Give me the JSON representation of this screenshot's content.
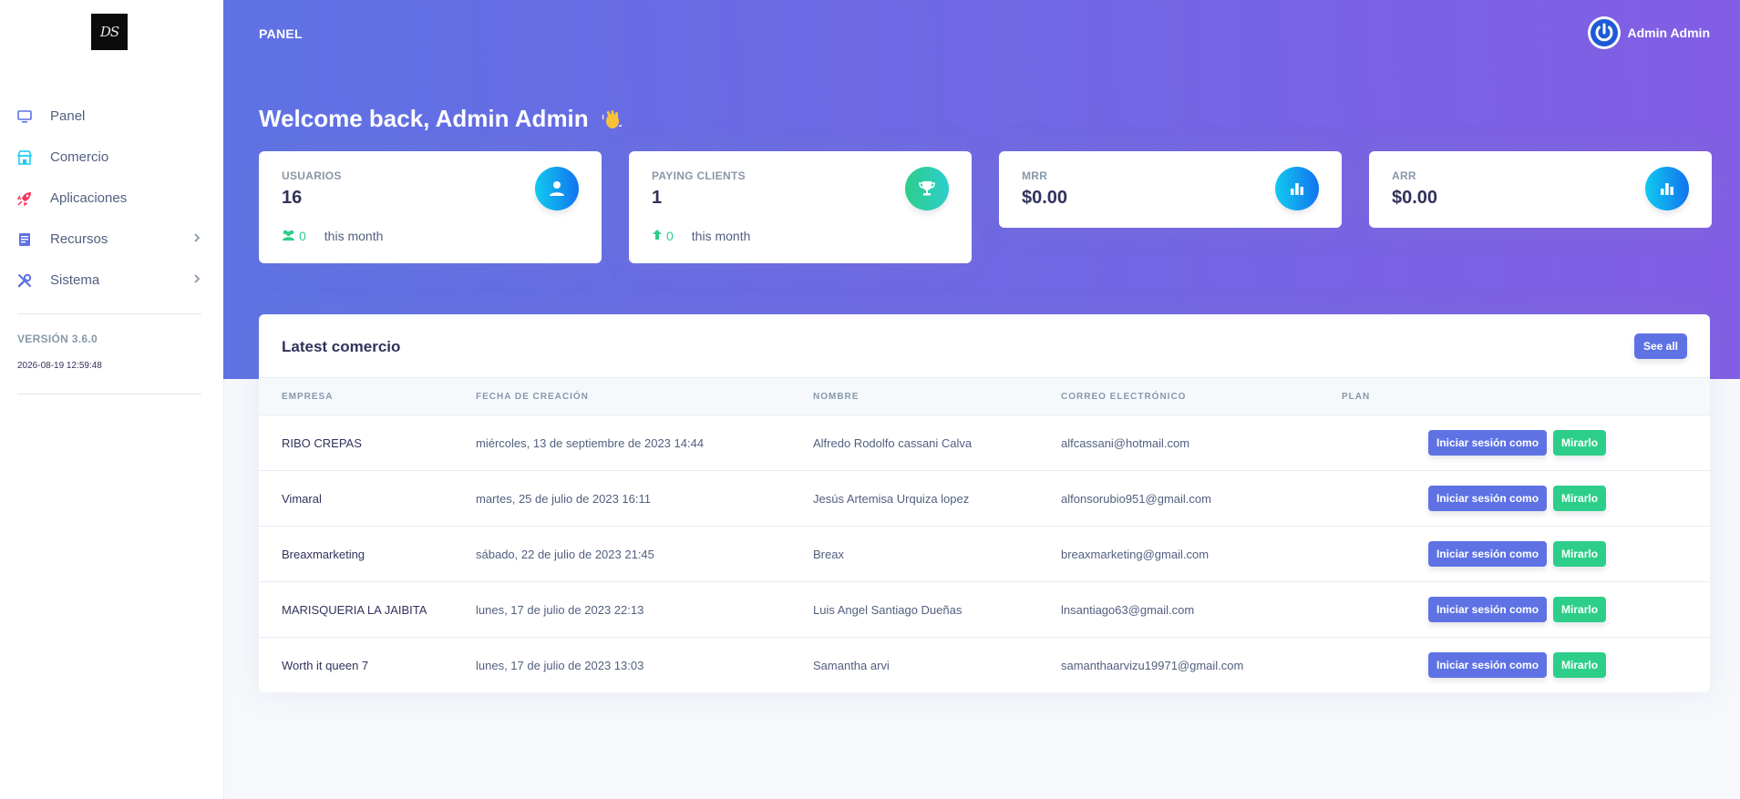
{
  "sidebar": {
    "logo_text": "DS",
    "items": [
      {
        "label": "Panel",
        "icon": "monitor-icon",
        "color": "#5e72e4"
      },
      {
        "label": "Comercio",
        "icon": "store-icon",
        "color": "#11cdef"
      },
      {
        "label": "Aplicaciones",
        "icon": "rocket-icon",
        "color": "#f5365c"
      },
      {
        "label": "Recursos",
        "icon": "document-icon",
        "color": "#5e72e4",
        "has_submenu": true
      },
      {
        "label": "Sistema",
        "icon": "tools-icon",
        "color": "#5e72e4",
        "has_submenu": true
      }
    ],
    "version": "VERSIÓN 3.6.0",
    "datetime": "2026-08-19 12:59:48"
  },
  "header": {
    "breadcrumb": "PANEL",
    "user_name": "Admin Admin",
    "welcome": "Welcome back, Admin Admin",
    "welcome_emoji": "waving-hand-icon"
  },
  "stats": [
    {
      "title": "USUARIOS",
      "value": "16",
      "icon": "user-icon",
      "color": "#11cdef",
      "foot_icon": "users-icon",
      "foot_value": "0",
      "foot_text": "this month"
    },
    {
      "title": "PAYING CLIENTS",
      "value": "1",
      "icon": "trophy-icon",
      "color": "#2dce89",
      "foot_icon": "arrow-up-icon",
      "foot_value": "0",
      "foot_text": "this month"
    },
    {
      "title": "MRR",
      "value": "$0.00",
      "icon": "bar-chart-icon",
      "color": "#11cdef"
    },
    {
      "title": "ARR",
      "value": "$0.00",
      "icon": "bar-chart-icon",
      "color": "#11cdef"
    }
  ],
  "table": {
    "title": "Latest comercio",
    "see_all": "See all",
    "columns": [
      "EMPRESA",
      "FECHA DE CREACIÓN",
      "NOMBRE",
      "CORREO ELECTRÓNICO",
      "PLAN"
    ],
    "login_label": "Iniciar sesión como",
    "view_label": "Mirarlo",
    "rows": [
      {
        "empresa": "RIBO CREPAS",
        "fecha": "miércoles, 13 de septiembre de 2023 14:44",
        "nombre": "Alfredo Rodolfo cassani Calva",
        "correo": "alfcassani@hotmail.com",
        "plan": ""
      },
      {
        "empresa": "Vimaral",
        "fecha": "martes, 25 de julio de 2023 16:11",
        "nombre": "Jesús Artemisa Urquiza lopez",
        "correo": "alfonsorubio951@gmail.com",
        "plan": ""
      },
      {
        "empresa": "Breaxmarketing",
        "fecha": "sábado, 22 de julio de 2023 21:45",
        "nombre": "Breax",
        "correo": "breaxmarketing@gmail.com",
        "plan": ""
      },
      {
        "empresa": "MARISQUERIA LA JAIBITA",
        "fecha": "lunes, 17 de julio de 2023 22:13",
        "nombre": "Luis Angel Santiago Dueñas",
        "correo": "lnsantiago63@gmail.com",
        "plan": ""
      },
      {
        "empresa": "Worth it queen 7",
        "fecha": "lunes, 17 de julio de 2023 13:03",
        "nombre": "Samantha arvi",
        "correo": "samanthaarvizu19971@gmail.com",
        "plan": ""
      }
    ]
  },
  "colors": {
    "primary": "#5e72e4",
    "purple": "#825ee4",
    "success": "#2dce89",
    "info": "#11cdef",
    "danger": "#f5365c"
  }
}
